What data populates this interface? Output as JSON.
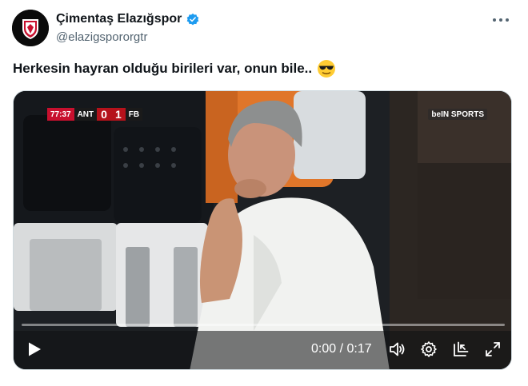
{
  "author": {
    "display_name": "Çimentaş Elazığspor",
    "handle": "@elazigspororgtr",
    "avatar_icon": "elazigspor-crest-icon",
    "verified_icon": "verified-badge-icon",
    "verified_color": "#1d9bf0"
  },
  "tweet": {
    "text": "Herkesin hayran olduğu birileri var, onun bile..",
    "emoji_icon": "sunglasses-emoji-icon"
  },
  "video": {
    "scorebug": {
      "time": "77:37",
      "home_team": "ANT",
      "home_score": "0",
      "away_score": "1",
      "away_team": "FB"
    },
    "channel_logo": "beIN SPORTS",
    "elapsed": "0:00",
    "separator": " / ",
    "duration": "0:17",
    "progress_percent": 0,
    "controls": {
      "play_icon": "play-icon",
      "volume_icon": "volume-icon",
      "settings_icon": "gear-icon",
      "pip_icon": "picture-in-picture-icon",
      "fullscreen_icon": "fullscreen-icon"
    }
  },
  "colors": {
    "text_primary": "#0f1419",
    "text_secondary": "#536471",
    "scorebug_red": "#c8102e"
  }
}
